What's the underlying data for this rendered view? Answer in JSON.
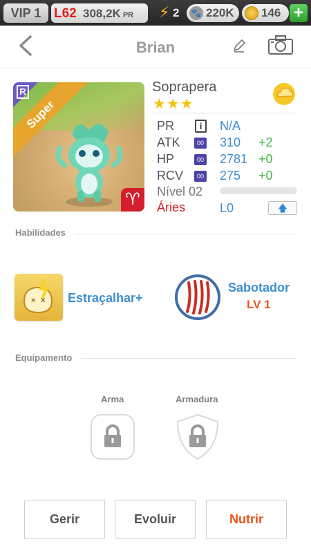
{
  "status_bar": {
    "vip": "VIP 1",
    "level": "L62",
    "power": "308,2K",
    "power_unit": "PR",
    "energy": "2",
    "paws": "220K",
    "coins": "146",
    "add": "+"
  },
  "header": {
    "title": "Brian"
  },
  "monster": {
    "rarity_letter": "R",
    "grade": "Super",
    "name": "Soprapera",
    "stars": "★★★",
    "sign_symbol": "♈"
  },
  "stats": {
    "pr": {
      "label": "PR",
      "info": "i",
      "value": "N/A"
    },
    "atk": {
      "label": "ATK",
      "chip": "00",
      "value": "310",
      "bonus": "+2"
    },
    "hp": {
      "label": "HP",
      "chip": "00",
      "value": "2781",
      "bonus": "+0"
    },
    "rcv": {
      "label": "RCV",
      "chip": "00",
      "value": "275",
      "bonus": "+0"
    },
    "level_label": "Nível 02",
    "level_progress": 0,
    "sign": "Áries",
    "sign_level": "L0",
    "upgrade_arrow": "🡅"
  },
  "abilities": {
    "section_label": "Habilidades",
    "skill1": {
      "name": "Estraçalhar+"
    },
    "skill2": {
      "name": "Sabotador",
      "level": "LV 1"
    }
  },
  "equipment": {
    "section_label": "Equipamento",
    "weapon_label": "Arma",
    "armor_label": "Armadura"
  },
  "actions": {
    "manage": "Gerir",
    "evolve": "Evoluir",
    "feed": "Nutrir"
  },
  "colors": {
    "accent_blue": "#3d8ed0",
    "accent_orange": "#e8531b",
    "bonus_green": "#45b845",
    "aries_red": "#d51f2a"
  }
}
